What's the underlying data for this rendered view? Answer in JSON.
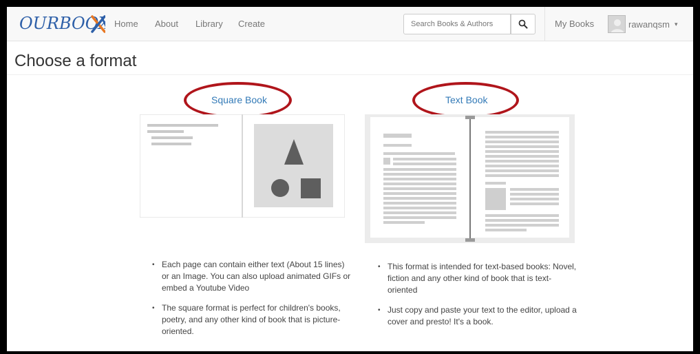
{
  "navbar": {
    "logo_text": "OURBOOX",
    "links": [
      "Home",
      "About",
      "Library",
      "Create"
    ],
    "search_placeholder": "Search Books & Authors",
    "search_icon": "search-icon",
    "my_books": "My Books",
    "username": "rawanqsm",
    "user_caret": "▾"
  },
  "page": {
    "title": "Choose a format"
  },
  "formats": {
    "square": {
      "label": "Square Book",
      "bullets": [
        "Each page can contain either text (About 15 lines) or an Image. You can also upload animated GIFs or embed a Youtube Video",
        "The square format is perfect for children's books, poetry, and any other kind of book that is picture-oriented."
      ]
    },
    "text": {
      "label": "Text Book",
      "bullets": [
        "This format is intended for text-based books: Novel, fiction and any other kind of book that is text-oriented",
        "Just copy and paste your text to the editor, upload a cover and presto! It's a book."
      ]
    }
  },
  "colors": {
    "link_blue": "#337ab7",
    "highlight_red": "#b0151b",
    "logo_blue": "#2d5fa8",
    "logo_orange": "#e87722"
  }
}
